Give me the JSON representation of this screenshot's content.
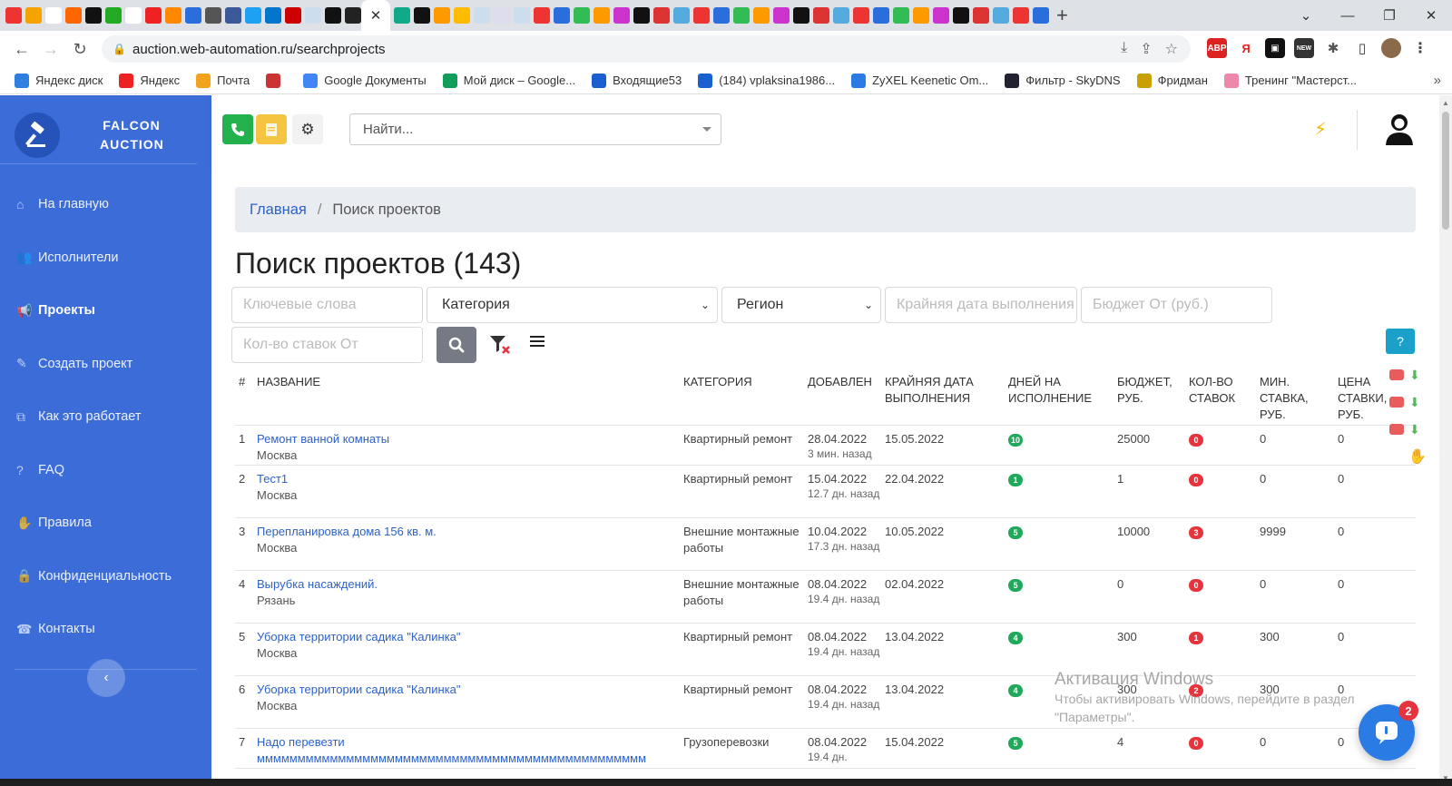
{
  "browser": {
    "url": "auction.web-automation.ru/searchprojects",
    "tab_icon_colors": [
      "#e33",
      "#f4a300",
      "#fff",
      "#f60",
      "#111",
      "#2a2",
      "#fff",
      "#e22",
      "#f80",
      "#2a6ede",
      "#555",
      "#3b5998",
      "#1da1f2",
      "#07c",
      "#c00",
      "#cde",
      "#111",
      "#222",
      "#1a8",
      "#111",
      "#f90",
      "#fb0",
      "#cde",
      "#dde",
      "#cde"
    ],
    "bookmarks": [
      {
        "label": "Яндекс диск",
        "icon": "yandex-disk-icon",
        "color": "#2f7fe0"
      },
      {
        "label": "Яндекс",
        "icon": "yandex-icon",
        "color": "#e22"
      },
      {
        "label": "Почта",
        "icon": "mail-icon",
        "color": "#f3a31b"
      },
      {
        "label": "",
        "icon": "bookmark-icon",
        "color": "#c33"
      },
      {
        "label": "Google Документы",
        "icon": "google-docs-icon",
        "color": "#4285f4"
      },
      {
        "label": "Мой диск – Google...",
        "icon": "google-drive-icon",
        "color": "#0f9d58"
      },
      {
        "label": "Входящие53",
        "icon": "inbox-icon",
        "color": "#1a5fd0"
      },
      {
        "label": "(184) vplaksina1986...",
        "icon": "inbox-icon",
        "color": "#1a5fd0"
      },
      {
        "label": "ZyXEL Keenetic Om...",
        "icon": "keenetic-icon",
        "color": "#2a7be4"
      },
      {
        "label": "Фильтр - SkyDNS",
        "icon": "shield-icon",
        "color": "#223"
      },
      {
        "label": "Фридман",
        "icon": "coin-icon",
        "color": "#c9a000"
      },
      {
        "label": "Тренинг \"Мастерст...",
        "icon": "training-icon",
        "color": "#e8a"
      }
    ]
  },
  "brand": {
    "line1": "FALCON",
    "line2": "AUCTION"
  },
  "nav": [
    {
      "label": "На главную",
      "icon": "home-icon",
      "glyph": "⌂",
      "active": false
    },
    {
      "label": "Исполнители",
      "icon": "users-icon",
      "glyph": "👥",
      "active": false
    },
    {
      "label": "Проекты",
      "icon": "megaphone-icon",
      "glyph": "📢",
      "active": true
    },
    {
      "label": "Создать проект",
      "icon": "edit-icon",
      "glyph": "✎",
      "active": false
    },
    {
      "label": "Как это работает",
      "icon": "sitemap-icon",
      "glyph": "⧉",
      "active": false
    },
    {
      "label": "FAQ",
      "icon": "question-icon",
      "glyph": "?",
      "active": false
    },
    {
      "label": "Правила",
      "icon": "hand-icon",
      "glyph": "✋",
      "active": false
    },
    {
      "label": "Конфиденциальность",
      "icon": "lock-icon",
      "glyph": "🔒",
      "active": false
    },
    {
      "label": "Контакты",
      "icon": "contacts-icon",
      "glyph": "☎",
      "active": false
    }
  ],
  "topbar": {
    "search_placeholder": "Найти...",
    "colors": {
      "phone_btn": "#22b14c",
      "doc_btn": "#f5c542",
      "bolt": "#f5b800"
    }
  },
  "breadcrumb": {
    "home": "Главная",
    "current": "Поиск проектов"
  },
  "page_title": "Поиск проектов",
  "project_count": "(143)",
  "filters": {
    "keywords_placeholder": "Ключевые слова",
    "category": "Категория",
    "region": "Регион",
    "deadline_placeholder": "Крайняя дата выполнения",
    "budget_placeholder": "Бюджет От (руб.)",
    "bids_placeholder": "Кол-во ставок От"
  },
  "table": {
    "headers": {
      "num": "#",
      "name": "НАЗВАНИЕ",
      "category": "КАТЕГОРИЯ",
      "added": "ДОБАВЛЕН",
      "deadline": "КРАЙНЯЯ ДАТА ВЫПОЛНЕНИЯ",
      "days": "ДНЕЙ НА ИСПОЛНЕНИЕ",
      "budget": "БЮДЖЕТ, РУБ.",
      "bids": "КОЛ-ВО СТАВОК",
      "min_bid": "МИН. СТАВКА, РУБ.",
      "bid_price": "ЦЕНА СТАВКИ, РУБ."
    },
    "rows": [
      {
        "num": "1",
        "name": "Ремонт ванной комнаты",
        "city": "Москва",
        "category": "Квартирный ремонт",
        "added": "28.04.2022",
        "ago": "3 мин. назад",
        "deadline": "15.05.2022",
        "days": "10",
        "budget": "25000",
        "bids": "0",
        "min_bid": "0",
        "price": "0"
      },
      {
        "num": "2",
        "name": "Тест1",
        "city": "Москва",
        "category": "Квартирный ремонт",
        "added": "15.04.2022",
        "ago": "12.7 дн. назад",
        "deadline": "22.04.2022",
        "days": "1",
        "budget": "1",
        "bids": "0",
        "min_bid": "0",
        "price": "0"
      },
      {
        "num": "3",
        "name": "Перепланировка дома 156 кв. м.",
        "city": "Москва",
        "category": "Внешние монтажные работы",
        "added": "10.04.2022",
        "ago": "17.3 дн. назад",
        "deadline": "10.05.2022",
        "days": "5",
        "budget": "10000",
        "bids": "3",
        "min_bid": "9999",
        "price": "0"
      },
      {
        "num": "4",
        "name": "Вырубка насаждений.",
        "city": "Рязань",
        "category": "Внешние монтажные работы",
        "added": "08.04.2022",
        "ago": "19.4 дн. назад",
        "deadline": "02.04.2022",
        "days": "5",
        "budget": "0",
        "bids": "0",
        "min_bid": "0",
        "price": "0"
      },
      {
        "num": "5",
        "name": "Уборка территории садика \"Калинка\"",
        "city": "Москва",
        "category": "Квартирный ремонт",
        "added": "08.04.2022",
        "ago": "19.4 дн. назад",
        "deadline": "13.04.2022",
        "days": "4",
        "budget": "300",
        "bids": "1",
        "min_bid": "300",
        "price": "0"
      },
      {
        "num": "6",
        "name": "Уборка территории садика \"Калинка\"",
        "city": "Москва",
        "category": "Квартирный ремонт",
        "added": "08.04.2022",
        "ago": "19.4 дн. назад",
        "deadline": "13.04.2022",
        "days": "4",
        "budget": "300",
        "bids": "2",
        "min_bid": "300",
        "price": "0"
      },
      {
        "num": "7",
        "name": "Надо перевезти",
        "city": "мммммммммммммммммммммммммммммммммммммммммммммммм",
        "category": "Грузоперевозки",
        "added": "08.04.2022",
        "ago": "19.4 дн.",
        "deadline": "15.04.2022",
        "days": "5",
        "budget": "4",
        "bids": "0",
        "min_bid": "0",
        "price": "0"
      }
    ]
  },
  "watermark": {
    "title": "Активация Windows",
    "text": "Чтобы активировать Windows, перейдите в раздел \"Параметры\"."
  },
  "chat": {
    "count": "2"
  }
}
